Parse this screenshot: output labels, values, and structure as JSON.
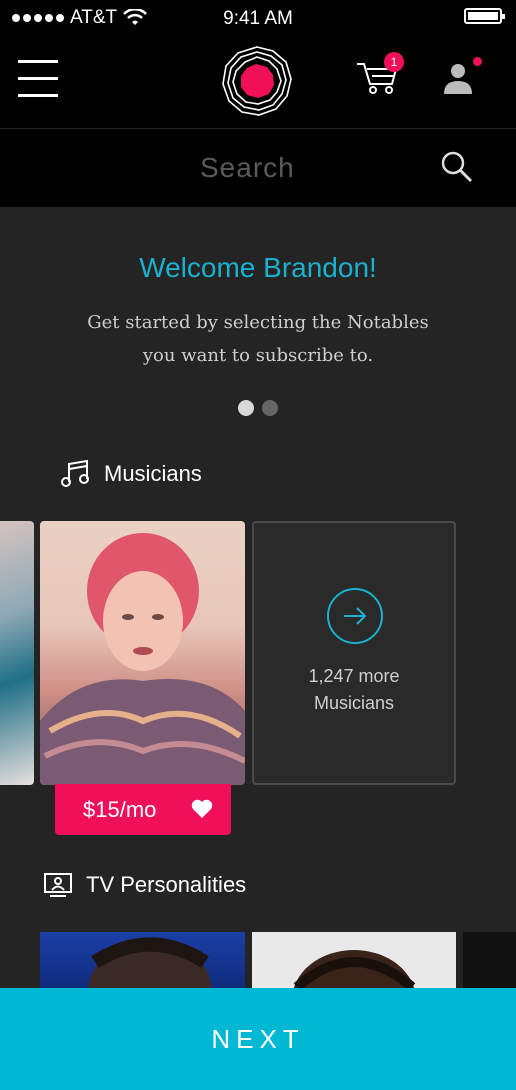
{
  "status_bar": {
    "carrier": "AT&T",
    "time": "9:41 AM"
  },
  "nav": {
    "cart_count": "1"
  },
  "search": {
    "placeholder": "Search"
  },
  "welcome": {
    "title": "Welcome Brandon!",
    "message": "Get started by selecting the Notables you want to subscribe to."
  },
  "pager": {
    "pages": 2,
    "active": 1
  },
  "sections": {
    "musicians": {
      "label": "Musicians",
      "price": "$15/mo",
      "more_count": "1,247 more",
      "more_label": "Musicians"
    },
    "tv": {
      "label": "TV Personalities"
    }
  },
  "footer": {
    "next_label": "NEXT"
  },
  "colors": {
    "accent": "#1ab1cf",
    "pink": "#f0105a",
    "next": "#00b8d4",
    "background": "#242424"
  },
  "icons": [
    "menu-icon",
    "logo-icon",
    "cart-icon",
    "profile-icon",
    "search-icon",
    "music-note-icon",
    "arrow-right-icon",
    "heart-icon",
    "tv-icon"
  ]
}
